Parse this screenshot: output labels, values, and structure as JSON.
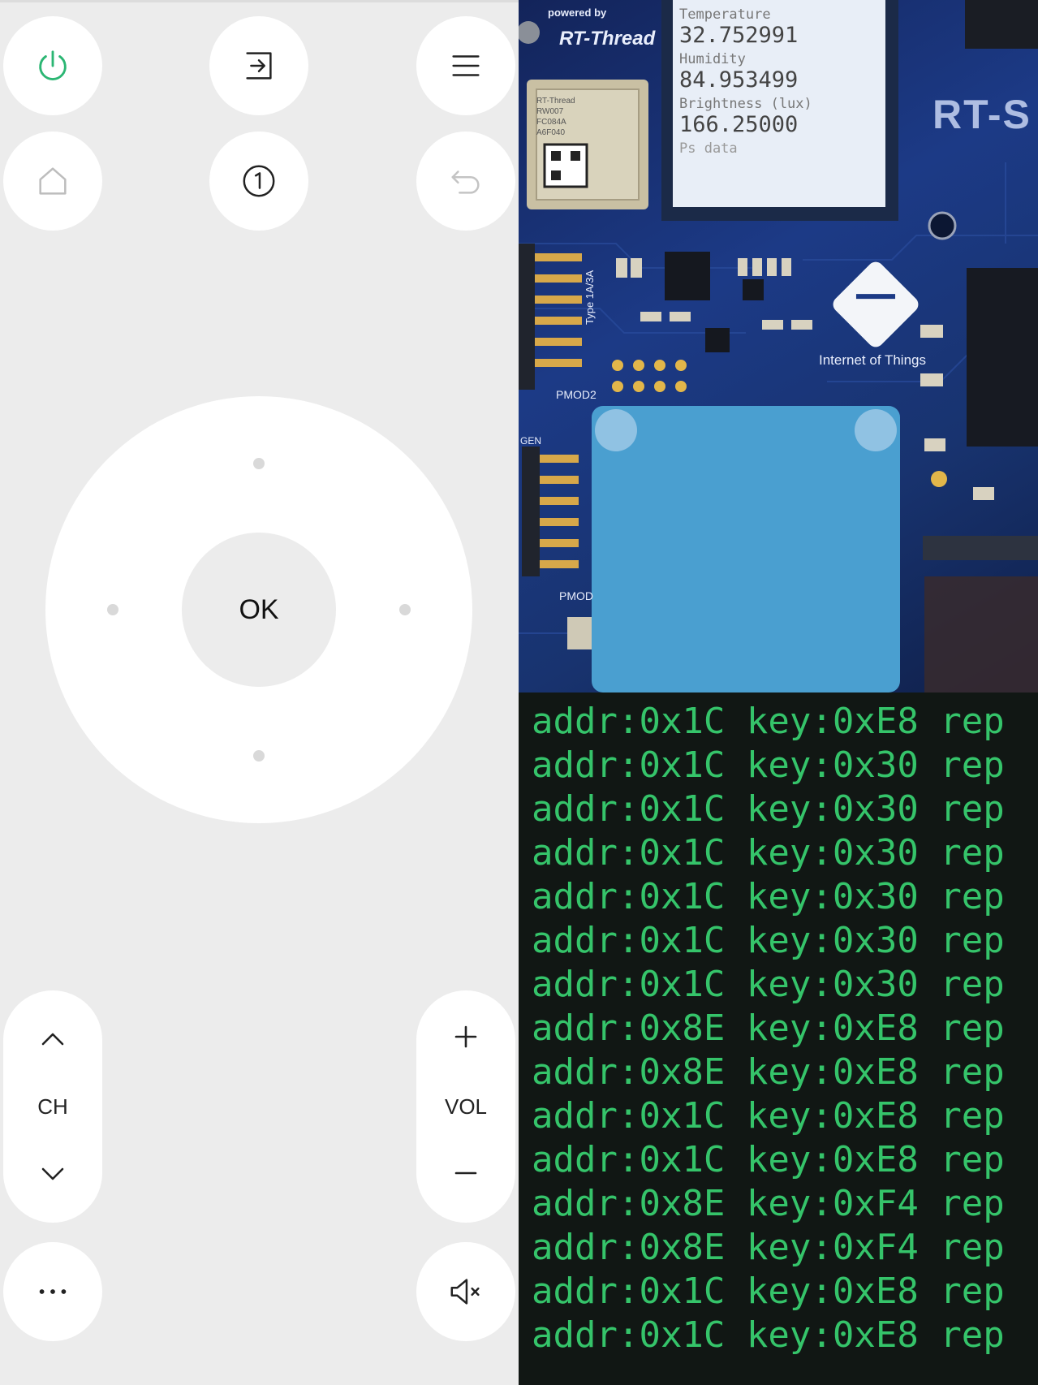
{
  "remote": {
    "ok_label": "OK",
    "ch_label": "CH",
    "vol_label": "VOL",
    "power_color": "#2bb673",
    "icons": {
      "power": "power-icon",
      "input": "input-icon",
      "menu": "menu-icon",
      "home": "home-icon",
      "number": "number-one-icon",
      "back": "back-icon",
      "ch_up": "chevron-up-icon",
      "ch_down": "chevron-down-icon",
      "vol_up": "plus-icon",
      "vol_down": "minus-icon",
      "more": "more-icon",
      "mute": "mute-icon"
    }
  },
  "photo": {
    "powered_by": "powered by",
    "brand": "RT-Thread",
    "lcd": {
      "temp_label": "Temperature",
      "temp_value": "32.752991",
      "humidity_label": "Humidity",
      "humidity_value": "84.953499",
      "brightness_label": "Brightness (lux)",
      "brightness_value": "166.25000",
      "ps_label": "Ps data"
    },
    "iot_label": "Internet of Things",
    "pmod2_label": "PMOD2",
    "pmod_label": "PMOD",
    "board_label": "RT-S",
    "module_text": "RT-Thread RW007 FC084A A6F040",
    "type_label": "Type 1A/3A",
    "gen_label": "GEN"
  },
  "terminal": {
    "color": "#35c46a",
    "lines": [
      "addr:0x1C key:0xE8 rep",
      "addr:0x1C key:0x30 rep",
      "addr:0x1C key:0x30 rep",
      "addr:0x1C key:0x30 rep",
      "addr:0x1C key:0x30 rep",
      "addr:0x1C key:0x30 rep",
      "addr:0x1C key:0x30 rep",
      "addr:0x8E key:0xE8 rep",
      "addr:0x8E key:0xE8 rep",
      "addr:0x1C key:0xE8 rep",
      "addr:0x1C key:0xE8 rep",
      "addr:0x8E key:0xF4 rep",
      "addr:0x8E key:0xF4 rep",
      "addr:0x1C key:0xE8 rep",
      "addr:0x1C key:0xE8 rep"
    ]
  }
}
